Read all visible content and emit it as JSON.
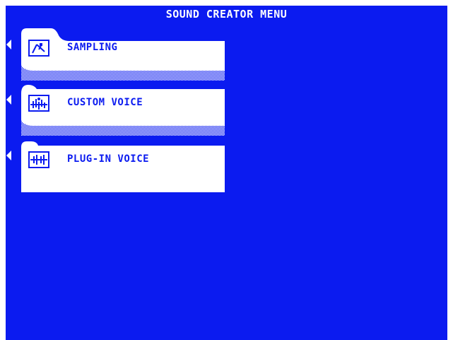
{
  "title": "SOUND CREATOR MENU",
  "colors": {
    "screen_bg": "#0b1bf0",
    "tab_bg": "#ffffff",
    "text": "#0b1bf0"
  },
  "menu": [
    {
      "label": "SAMPLING",
      "icon": "sampling-icon"
    },
    {
      "label": "CUSTOM VOICE",
      "icon": "custom-voice-icon"
    },
    {
      "label": "PLUG-IN VOICE",
      "icon": "plug-in-voice-icon"
    }
  ]
}
